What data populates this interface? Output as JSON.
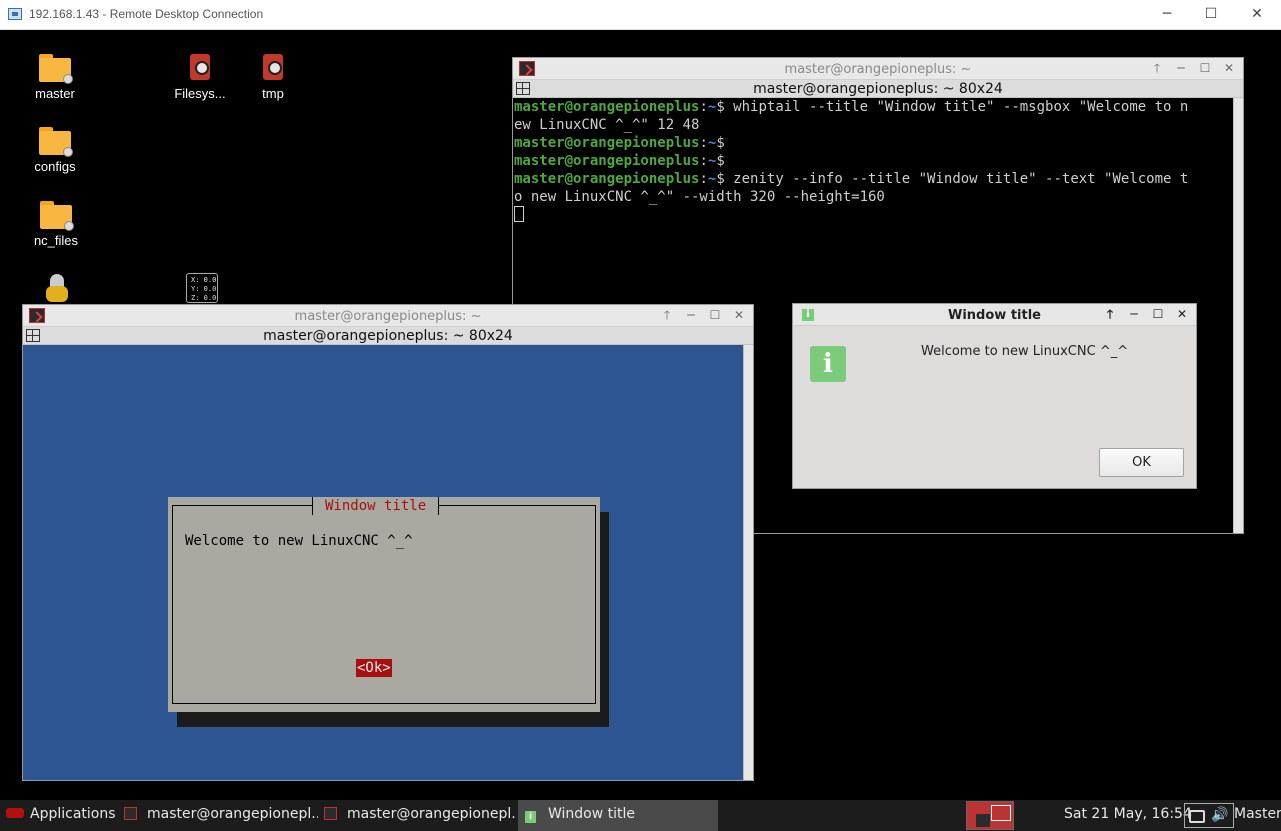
{
  "rdp": {
    "title": "192.168.1.43 - Remote Desktop Connection",
    "minimize": "─",
    "maximize": "☐",
    "close": "✕"
  },
  "desktop_icons": [
    {
      "label": "master"
    },
    {
      "label": "Filesys..."
    },
    {
      "label": "tmp"
    },
    {
      "label": "configs"
    },
    {
      "label": "nc_files"
    }
  ],
  "dro_icon": {
    "lines": [
      "X: 0.0",
      "Y: 0.0",
      "Z: 0.0"
    ]
  },
  "terminal_back": {
    "title": "master@orangepioneplus: ~",
    "subtitle": "master@orangepioneplus: ~ 80x24",
    "user": "master@orangepioneplus",
    "path": "~",
    "lines": [
      {
        "cmd": "whiptail --title \"Window title\" --msgbox \"Welcome to n",
        "cont": "ew LinuxCNC ^_^\" 12 48"
      },
      {
        "cmd": "",
        "cont": ""
      },
      {
        "cmd": "",
        "cont": ""
      },
      {
        "cmd": "zenity --info --title \"Window title\" --text \"Welcome t",
        "cont": "o new LinuxCNC ^_^\" --width 320 --height=160"
      }
    ]
  },
  "terminal_front": {
    "title": "master@orangepioneplus: ~",
    "subtitle": "master@orangepioneplus: ~ 80x24"
  },
  "whiptail": {
    "title": "Window title",
    "message": "Welcome to new LinuxCNC ^_^",
    "ok": "<Ok>"
  },
  "zenity": {
    "title": "Window title",
    "message": "Welcome to new LinuxCNC ^_^",
    "ok": "OK",
    "icon_glyph": "i"
  },
  "window_buttons": {
    "up": "🡑",
    "min": "─",
    "max": "☐",
    "close": "✕"
  },
  "taskbar": {
    "applications": "Applications ☰",
    "items": [
      "master@orangepionepl...",
      "master@orangepionepl...",
      "Window title"
    ],
    "clock": "Sat 21 May, 16:54",
    "user": "Master"
  },
  "colors": {
    "prompt_user": "#4fa83d",
    "prompt_path": "#5b7fd1",
    "whiptail_bg": "#2d5592",
    "whiptail_accent": "#a81010",
    "zenity_info": "#7ccb7a"
  }
}
